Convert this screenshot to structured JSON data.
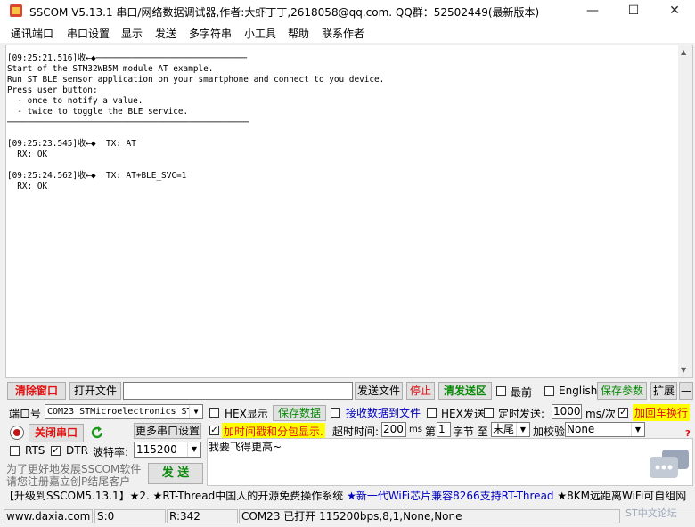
{
  "window": {
    "title": "SSCOM V5.13.1 串口/网络数据调试器,作者:大虾丁丁,2618058@qq.com. QQ群：52502449(最新版本)",
    "minimize": "—",
    "maximize": "☐",
    "close": "✕"
  },
  "menu": [
    "通讯端口",
    "串口设置",
    "显示",
    "发送",
    "多字符串",
    "小工具",
    "帮助",
    "联系作者"
  ],
  "receive": {
    "lines": "[09:25:21.516]收←◆──────────────────────────────\nStart of the STM32WB5M module AT example.\nRun ST BLE sensor application on your smartphone and connect to you device.\nPress user button:\n  - once to notify a value.\n  - twice to toggle the BLE service.\n────────────────────────────────────────────────\n\n[09:25:23.545]收←◆  TX: AT\n  RX: OK\n\n[09:25:24.562]收←◆  TX: AT+BLE_SVC=1\n  RX: OK"
  },
  "toolbar": {
    "clear_window": "清除窗口",
    "open_file": "打开文件",
    "send_file": "发送文件",
    "stop": "停止",
    "clear_send": "清发送区",
    "topmost": "最前",
    "english": "English",
    "save_params": "保存参数",
    "expand": "扩展",
    "dash": "—"
  },
  "port": {
    "label": "端口号",
    "value": "COM23 STMicroelectronics ST",
    "close_port": "关闭串口",
    "more_settings": "更多串口设置",
    "rts": "RTS",
    "dtr": "DTR",
    "baud_label": "波特率:",
    "baud_value": "115200",
    "promo1": "为了更好地发展SSCOM软件",
    "promo2": "请您注册嘉立创P结尾客户"
  },
  "options": {
    "hex_display": "HEX显示",
    "save_data": "保存数据",
    "recv_to_file": "接收数据到文件",
    "hex_send": "HEX发送",
    "timed_send": "定时发送:",
    "interval": "1000",
    "interval_unit": "ms/次",
    "add_crlf": "加回车换行",
    "timestamp": "加时间戳和分包显示.",
    "timeout_label": "超时时间:",
    "timeout_value": "200",
    "ms": "ms",
    "nth": "第",
    "byte_index": "1",
    "byte_label": "字节 至",
    "end_value": "末尾",
    "checksum_label": "加校验",
    "checksum_value": "None",
    "question": "?"
  },
  "send": {
    "text": "我要飞得更高~",
    "button": "发 送"
  },
  "ad": {
    "part1": "【升级到SSCOM5.13.1】★2. ★RT-Thread中国人的开源免费操作系统 ",
    "part2": "★新一代WiFi芯片兼容8266支持RT-Thread",
    "part3": " ★8KM远距离WiFi可自组网"
  },
  "status": {
    "site": "www.daxia.com",
    "sent": "S:0",
    "received": "R:342",
    "port_status": "COM23 已打开  115200bps,8,1,None,None",
    "watermark": "ST中文论坛"
  },
  "colors": {
    "red": "#e01010",
    "green": "#0a8a0a",
    "highlight": "#ffff00",
    "link_blue": "#0000c0"
  }
}
